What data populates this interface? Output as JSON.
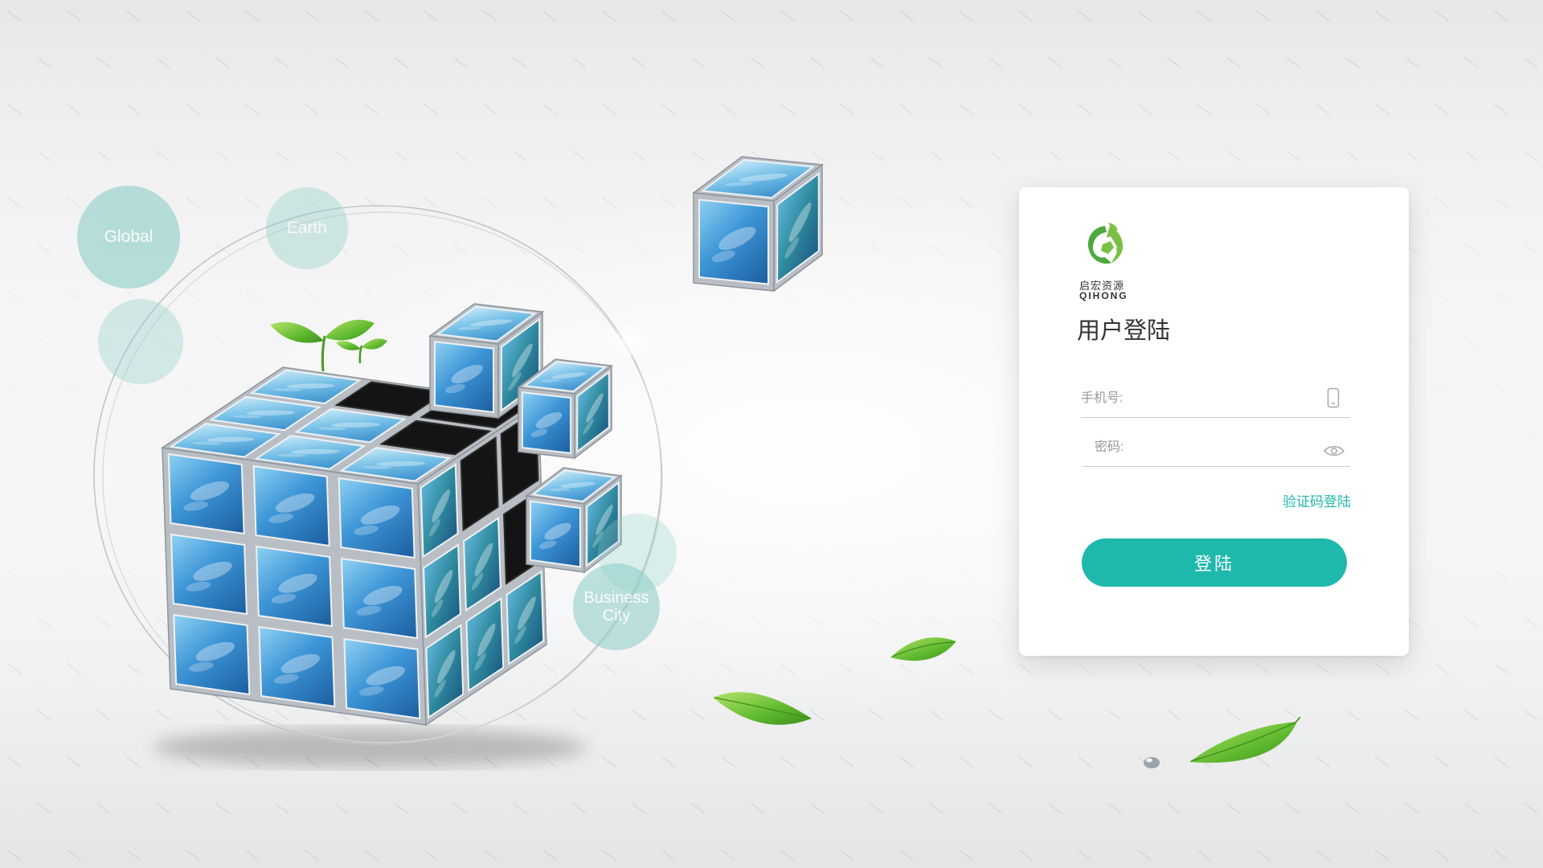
{
  "logo": {
    "name_cn": "启宏资源",
    "name_en": "QIHONG"
  },
  "login": {
    "title": "用户登陆",
    "phone": {
      "label": "手机号:",
      "icon": "phone-icon"
    },
    "password": {
      "label": "密码:",
      "icon": "eye-icon"
    },
    "sms_login_link": "验证码登陆",
    "submit_label": "登陆"
  },
  "bubbles": {
    "global": "Global",
    "earth": "Earth",
    "business_city": "Business City"
  },
  "theme": {
    "accent": "#1fb8ad",
    "logo_green": "#4fa83d",
    "bubble_fill": "#8fcfc9"
  }
}
